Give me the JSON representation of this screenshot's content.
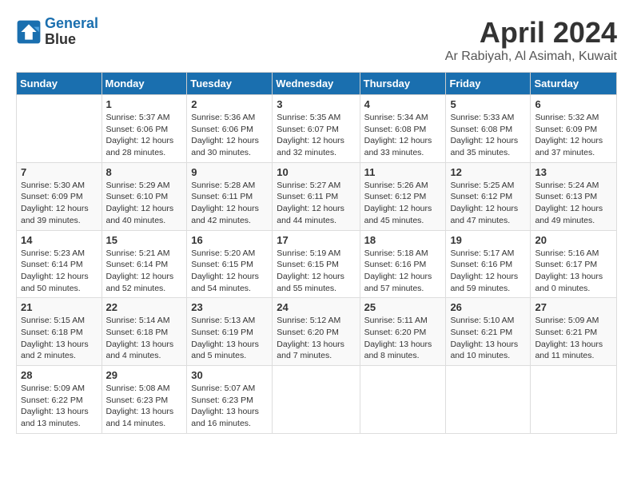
{
  "logo": {
    "line1": "General",
    "line2": "Blue"
  },
  "title": "April 2024",
  "location": "Ar Rabiyah, Al Asimah, Kuwait",
  "days_header": [
    "Sunday",
    "Monday",
    "Tuesday",
    "Wednesday",
    "Thursday",
    "Friday",
    "Saturday"
  ],
  "weeks": [
    [
      {
        "day": "",
        "sunrise": "",
        "sunset": "",
        "daylight": ""
      },
      {
        "day": "1",
        "sunrise": "5:37 AM",
        "sunset": "6:06 PM",
        "daylight": "12 hours and 28 minutes."
      },
      {
        "day": "2",
        "sunrise": "5:36 AM",
        "sunset": "6:06 PM",
        "daylight": "12 hours and 30 minutes."
      },
      {
        "day": "3",
        "sunrise": "5:35 AM",
        "sunset": "6:07 PM",
        "daylight": "12 hours and 32 minutes."
      },
      {
        "day": "4",
        "sunrise": "5:34 AM",
        "sunset": "6:08 PM",
        "daylight": "12 hours and 33 minutes."
      },
      {
        "day": "5",
        "sunrise": "5:33 AM",
        "sunset": "6:08 PM",
        "daylight": "12 hours and 35 minutes."
      },
      {
        "day": "6",
        "sunrise": "5:32 AM",
        "sunset": "6:09 PM",
        "daylight": "12 hours and 37 minutes."
      }
    ],
    [
      {
        "day": "7",
        "sunrise": "5:30 AM",
        "sunset": "6:09 PM",
        "daylight": "12 hours and 39 minutes."
      },
      {
        "day": "8",
        "sunrise": "5:29 AM",
        "sunset": "6:10 PM",
        "daylight": "12 hours and 40 minutes."
      },
      {
        "day": "9",
        "sunrise": "5:28 AM",
        "sunset": "6:11 PM",
        "daylight": "12 hours and 42 minutes."
      },
      {
        "day": "10",
        "sunrise": "5:27 AM",
        "sunset": "6:11 PM",
        "daylight": "12 hours and 44 minutes."
      },
      {
        "day": "11",
        "sunrise": "5:26 AM",
        "sunset": "6:12 PM",
        "daylight": "12 hours and 45 minutes."
      },
      {
        "day": "12",
        "sunrise": "5:25 AM",
        "sunset": "6:12 PM",
        "daylight": "12 hours and 47 minutes."
      },
      {
        "day": "13",
        "sunrise": "5:24 AM",
        "sunset": "6:13 PM",
        "daylight": "12 hours and 49 minutes."
      }
    ],
    [
      {
        "day": "14",
        "sunrise": "5:23 AM",
        "sunset": "6:14 PM",
        "daylight": "12 hours and 50 minutes."
      },
      {
        "day": "15",
        "sunrise": "5:21 AM",
        "sunset": "6:14 PM",
        "daylight": "12 hours and 52 minutes."
      },
      {
        "day": "16",
        "sunrise": "5:20 AM",
        "sunset": "6:15 PM",
        "daylight": "12 hours and 54 minutes."
      },
      {
        "day": "17",
        "sunrise": "5:19 AM",
        "sunset": "6:15 PM",
        "daylight": "12 hours and 55 minutes."
      },
      {
        "day": "18",
        "sunrise": "5:18 AM",
        "sunset": "6:16 PM",
        "daylight": "12 hours and 57 minutes."
      },
      {
        "day": "19",
        "sunrise": "5:17 AM",
        "sunset": "6:16 PM",
        "daylight": "12 hours and 59 minutes."
      },
      {
        "day": "20",
        "sunrise": "5:16 AM",
        "sunset": "6:17 PM",
        "daylight": "13 hours and 0 minutes."
      }
    ],
    [
      {
        "day": "21",
        "sunrise": "5:15 AM",
        "sunset": "6:18 PM",
        "daylight": "13 hours and 2 minutes."
      },
      {
        "day": "22",
        "sunrise": "5:14 AM",
        "sunset": "6:18 PM",
        "daylight": "13 hours and 4 minutes."
      },
      {
        "day": "23",
        "sunrise": "5:13 AM",
        "sunset": "6:19 PM",
        "daylight": "13 hours and 5 minutes."
      },
      {
        "day": "24",
        "sunrise": "5:12 AM",
        "sunset": "6:20 PM",
        "daylight": "13 hours and 7 minutes."
      },
      {
        "day": "25",
        "sunrise": "5:11 AM",
        "sunset": "6:20 PM",
        "daylight": "13 hours and 8 minutes."
      },
      {
        "day": "26",
        "sunrise": "5:10 AM",
        "sunset": "6:21 PM",
        "daylight": "13 hours and 10 minutes."
      },
      {
        "day": "27",
        "sunrise": "5:09 AM",
        "sunset": "6:21 PM",
        "daylight": "13 hours and 11 minutes."
      }
    ],
    [
      {
        "day": "28",
        "sunrise": "5:09 AM",
        "sunset": "6:22 PM",
        "daylight": "13 hours and 13 minutes."
      },
      {
        "day": "29",
        "sunrise": "5:08 AM",
        "sunset": "6:23 PM",
        "daylight": "13 hours and 14 minutes."
      },
      {
        "day": "30",
        "sunrise": "5:07 AM",
        "sunset": "6:23 PM",
        "daylight": "13 hours and 16 minutes."
      },
      {
        "day": "",
        "sunrise": "",
        "sunset": "",
        "daylight": ""
      },
      {
        "day": "",
        "sunrise": "",
        "sunset": "",
        "daylight": ""
      },
      {
        "day": "",
        "sunrise": "",
        "sunset": "",
        "daylight": ""
      },
      {
        "day": "",
        "sunrise": "",
        "sunset": "",
        "daylight": ""
      }
    ]
  ]
}
